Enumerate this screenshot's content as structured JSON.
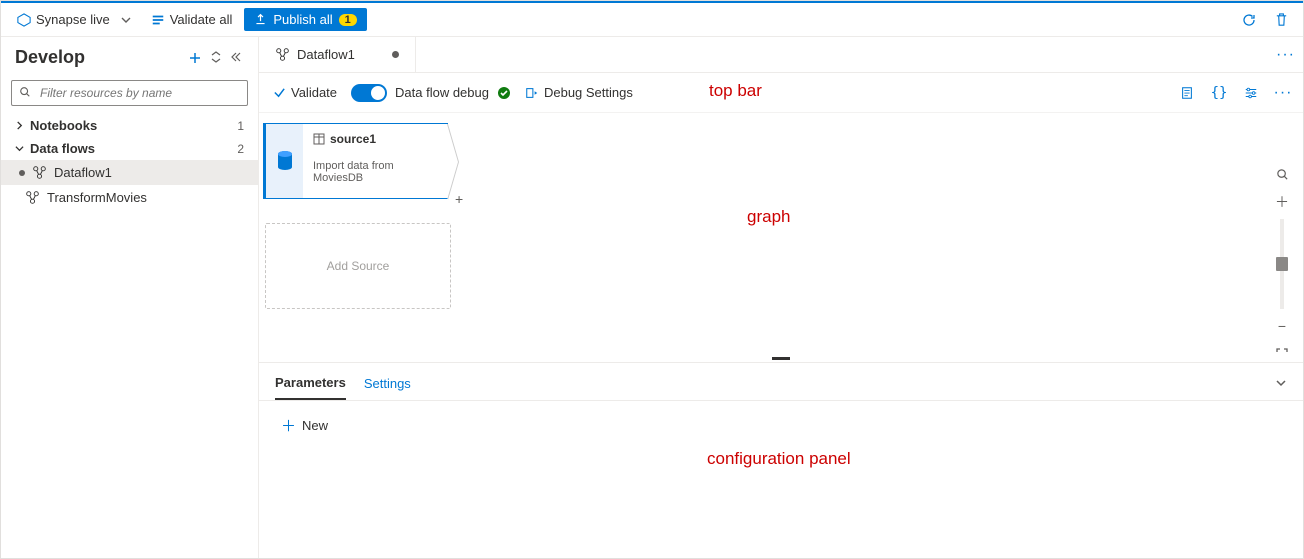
{
  "topbar": {
    "synapse_live": "Synapse live",
    "validate_all": "Validate all",
    "publish_all": "Publish all",
    "publish_count": "1"
  },
  "sidebar": {
    "title": "Develop",
    "filter_placeholder": "Filter resources by name",
    "sections": [
      {
        "label": "Notebooks",
        "count": "1"
      },
      {
        "label": "Data flows",
        "count": "2"
      }
    ],
    "dataflow_items": [
      {
        "label": "Dataflow1",
        "unsaved": true
      },
      {
        "label": "TransformMovies",
        "unsaved": false
      }
    ]
  },
  "tab": {
    "label": "Dataflow1"
  },
  "canvas_toolbar": {
    "validate": "Validate",
    "debug_label": "Data flow debug",
    "debug_settings": "Debug Settings"
  },
  "node": {
    "title": "source1",
    "desc": "Import data from MoviesDB"
  },
  "add_source": "Add Source",
  "config": {
    "tabs": [
      {
        "label": "Parameters"
      },
      {
        "label": "Settings"
      }
    ],
    "new_label": "New"
  },
  "annotations": {
    "topbar": "top bar",
    "graph": "graph",
    "config": "configuration panel"
  }
}
